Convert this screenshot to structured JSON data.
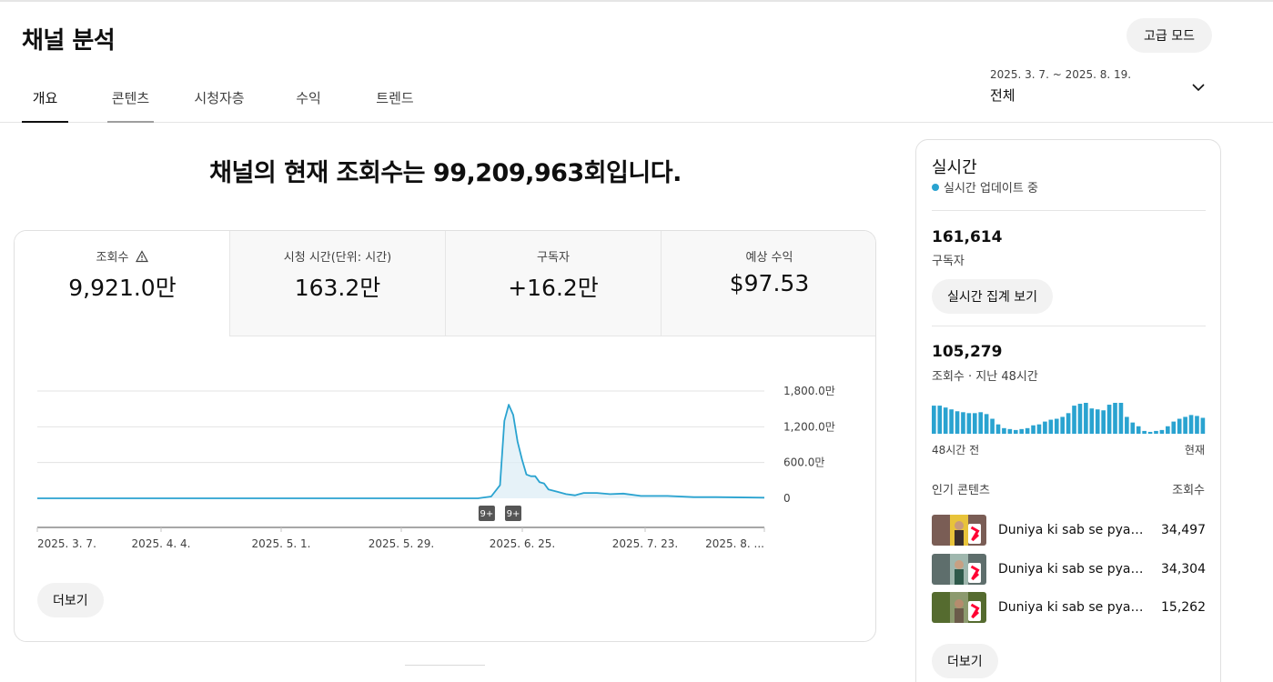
{
  "header": {
    "title": "채널 분석",
    "advanced_button": "고급 모드",
    "date_range": "2025. 3. 7. ~ 2025. 8. 19.",
    "period": "전체"
  },
  "tabs": [
    {
      "label": "개요",
      "active": true
    },
    {
      "label": "콘텐츠",
      "active": false
    },
    {
      "label": "시청자층",
      "active": false
    },
    {
      "label": "수익",
      "active": false
    },
    {
      "label": "트렌드",
      "active": false
    }
  ],
  "headline": "채널의 현재 조회수는 99,209,963회입니다.",
  "metrics": [
    {
      "label": "조회수",
      "value": "9,921.0만",
      "active": true,
      "warning_icon": "warning-triangle-icon"
    },
    {
      "label": "시청 시간(단위: 시간)",
      "value": "163.2만",
      "active": false
    },
    {
      "label": "구독자",
      "value": "+16.2만",
      "active": false
    },
    {
      "label": "예상 수익",
      "value": "$97.53",
      "active": false
    }
  ],
  "chart_data": {
    "type": "area",
    "x_ticks": [
      "2025. 3. 7.",
      "2025. 4. 4.",
      "2025. 5. 1.",
      "2025. 5. 29.",
      "2025. 6. 25.",
      "2025. 7. 23.",
      "2025. 8. ..."
    ],
    "y_ticks": [
      "1,800.0만",
      "1,200.0만",
      "600.0만",
      "0"
    ],
    "ylim": [
      0,
      18000000
    ],
    "x": [
      "2025-03-07",
      "2025-06-10",
      "2025-06-15",
      "2025-06-18",
      "2025-06-20",
      "2025-06-21",
      "2025-06-22",
      "2025-06-23",
      "2025-06-24",
      "2025-06-25",
      "2025-06-26",
      "2025-06-27",
      "2025-06-28",
      "2025-06-29",
      "2025-06-30",
      "2025-07-01",
      "2025-07-03",
      "2025-07-05",
      "2025-07-07",
      "2025-07-09",
      "2025-07-12",
      "2025-07-15",
      "2025-07-18",
      "2025-07-22",
      "2025-07-28",
      "2025-08-03",
      "2025-08-08",
      "2025-08-19"
    ],
    "values": [
      0,
      0,
      0,
      300000,
      2200000,
      13000000,
      15700000,
      14000000,
      9500000,
      6500000,
      4000000,
      3700000,
      3700000,
      2700000,
      2500000,
      1500000,
      1100000,
      700000,
      500000,
      900000,
      900000,
      700000,
      800000,
      400000,
      400000,
      200000,
      200000,
      100000
    ],
    "markers": [
      {
        "label": "9+",
        "x": "2025-06-17"
      },
      {
        "label": "9+",
        "x": "2025-06-23"
      }
    ],
    "grid": true
  },
  "chart_more_button": "더보기",
  "realtime": {
    "title": "실시간",
    "status": "실시간 업데이트 중",
    "subscribers_value": "161,614",
    "subscribers_label": "구독자",
    "live_count_button": "실시간 집계 보기",
    "views_value": "105,279",
    "views_label": "조회수 · 지난 48시간",
    "hourly_views": [
      30,
      30,
      28,
      26,
      24,
      23,
      22,
      22,
      23,
      21,
      16,
      10,
      6,
      5,
      4,
      5,
      6,
      9,
      10,
      13,
      15,
      16,
      18,
      22,
      30,
      32,
      33,
      27,
      26,
      25,
      31,
      33,
      33,
      18,
      12,
      8,
      3,
      2,
      3,
      4,
      8,
      13,
      16,
      18,
      20,
      19,
      17
    ],
    "bars_color": "#2aa3d0",
    "axis_start": "48시간 전",
    "axis_end": "현재",
    "top_header_left": "인기 콘텐츠",
    "top_header_right": "조회수",
    "top_items": [
      {
        "title": "Duniya ki sab se pyari a...",
        "views": "34,497"
      },
      {
        "title": "Duniya ki sab se pyari a...",
        "views": "34,304"
      },
      {
        "title": "Duniya ki sab se pyari a...",
        "views": "15,262"
      }
    ],
    "more_button": "더보기"
  },
  "colors": {
    "accent": "#2aa3d0",
    "shorts_badge": "#ff0033"
  }
}
